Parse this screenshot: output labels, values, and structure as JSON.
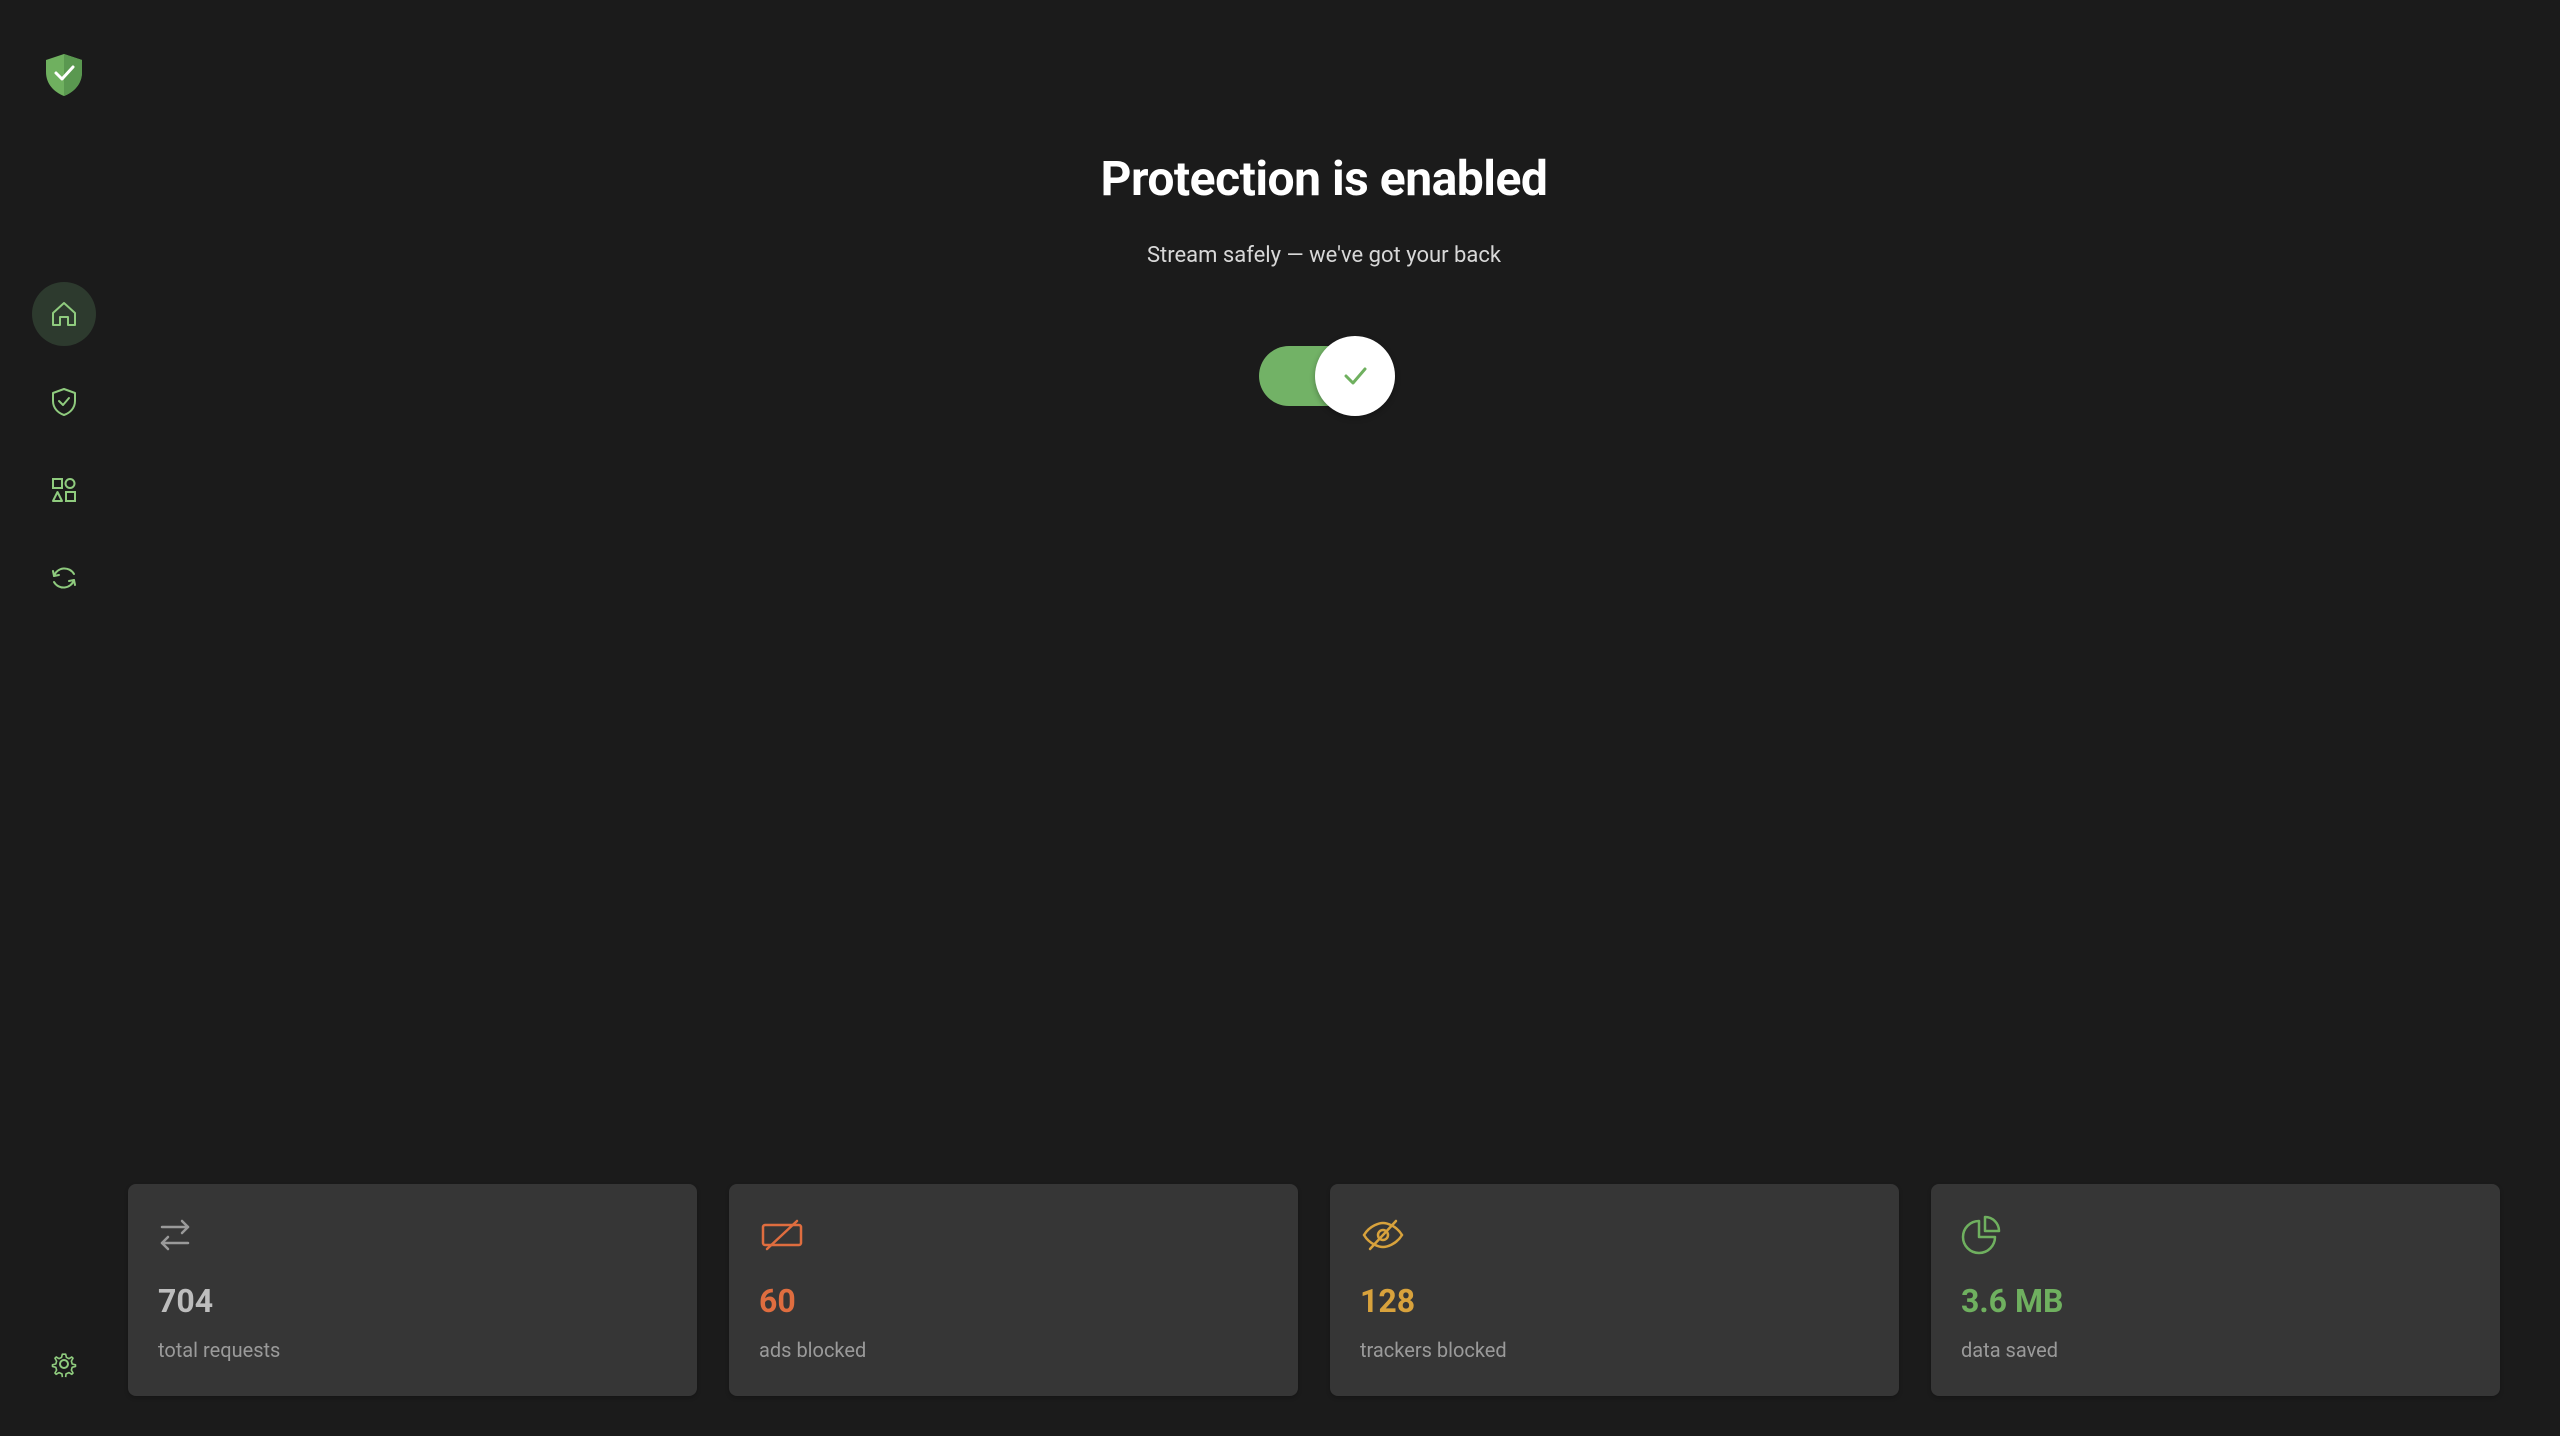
{
  "hero": {
    "title": "Protection is enabled",
    "subtitle": "Stream safely — we've got your back"
  },
  "toggle": {
    "enabled": true
  },
  "stats": [
    {
      "value": "704",
      "label": "total requests",
      "color": "gray",
      "icon": "arrows"
    },
    {
      "value": "60",
      "label": "ads blocked",
      "color": "orange",
      "icon": "ad-blocked"
    },
    {
      "value": "128",
      "label": "trackers blocked",
      "color": "yellow",
      "icon": "eye-off"
    },
    {
      "value": "3.6 MB",
      "label": "data saved",
      "color": "green",
      "icon": "pie"
    }
  ],
  "colors": {
    "green": "#6fb05f",
    "orange": "#df6d3f",
    "yellow": "#d8a23c",
    "gray": "#bdbdbd"
  }
}
